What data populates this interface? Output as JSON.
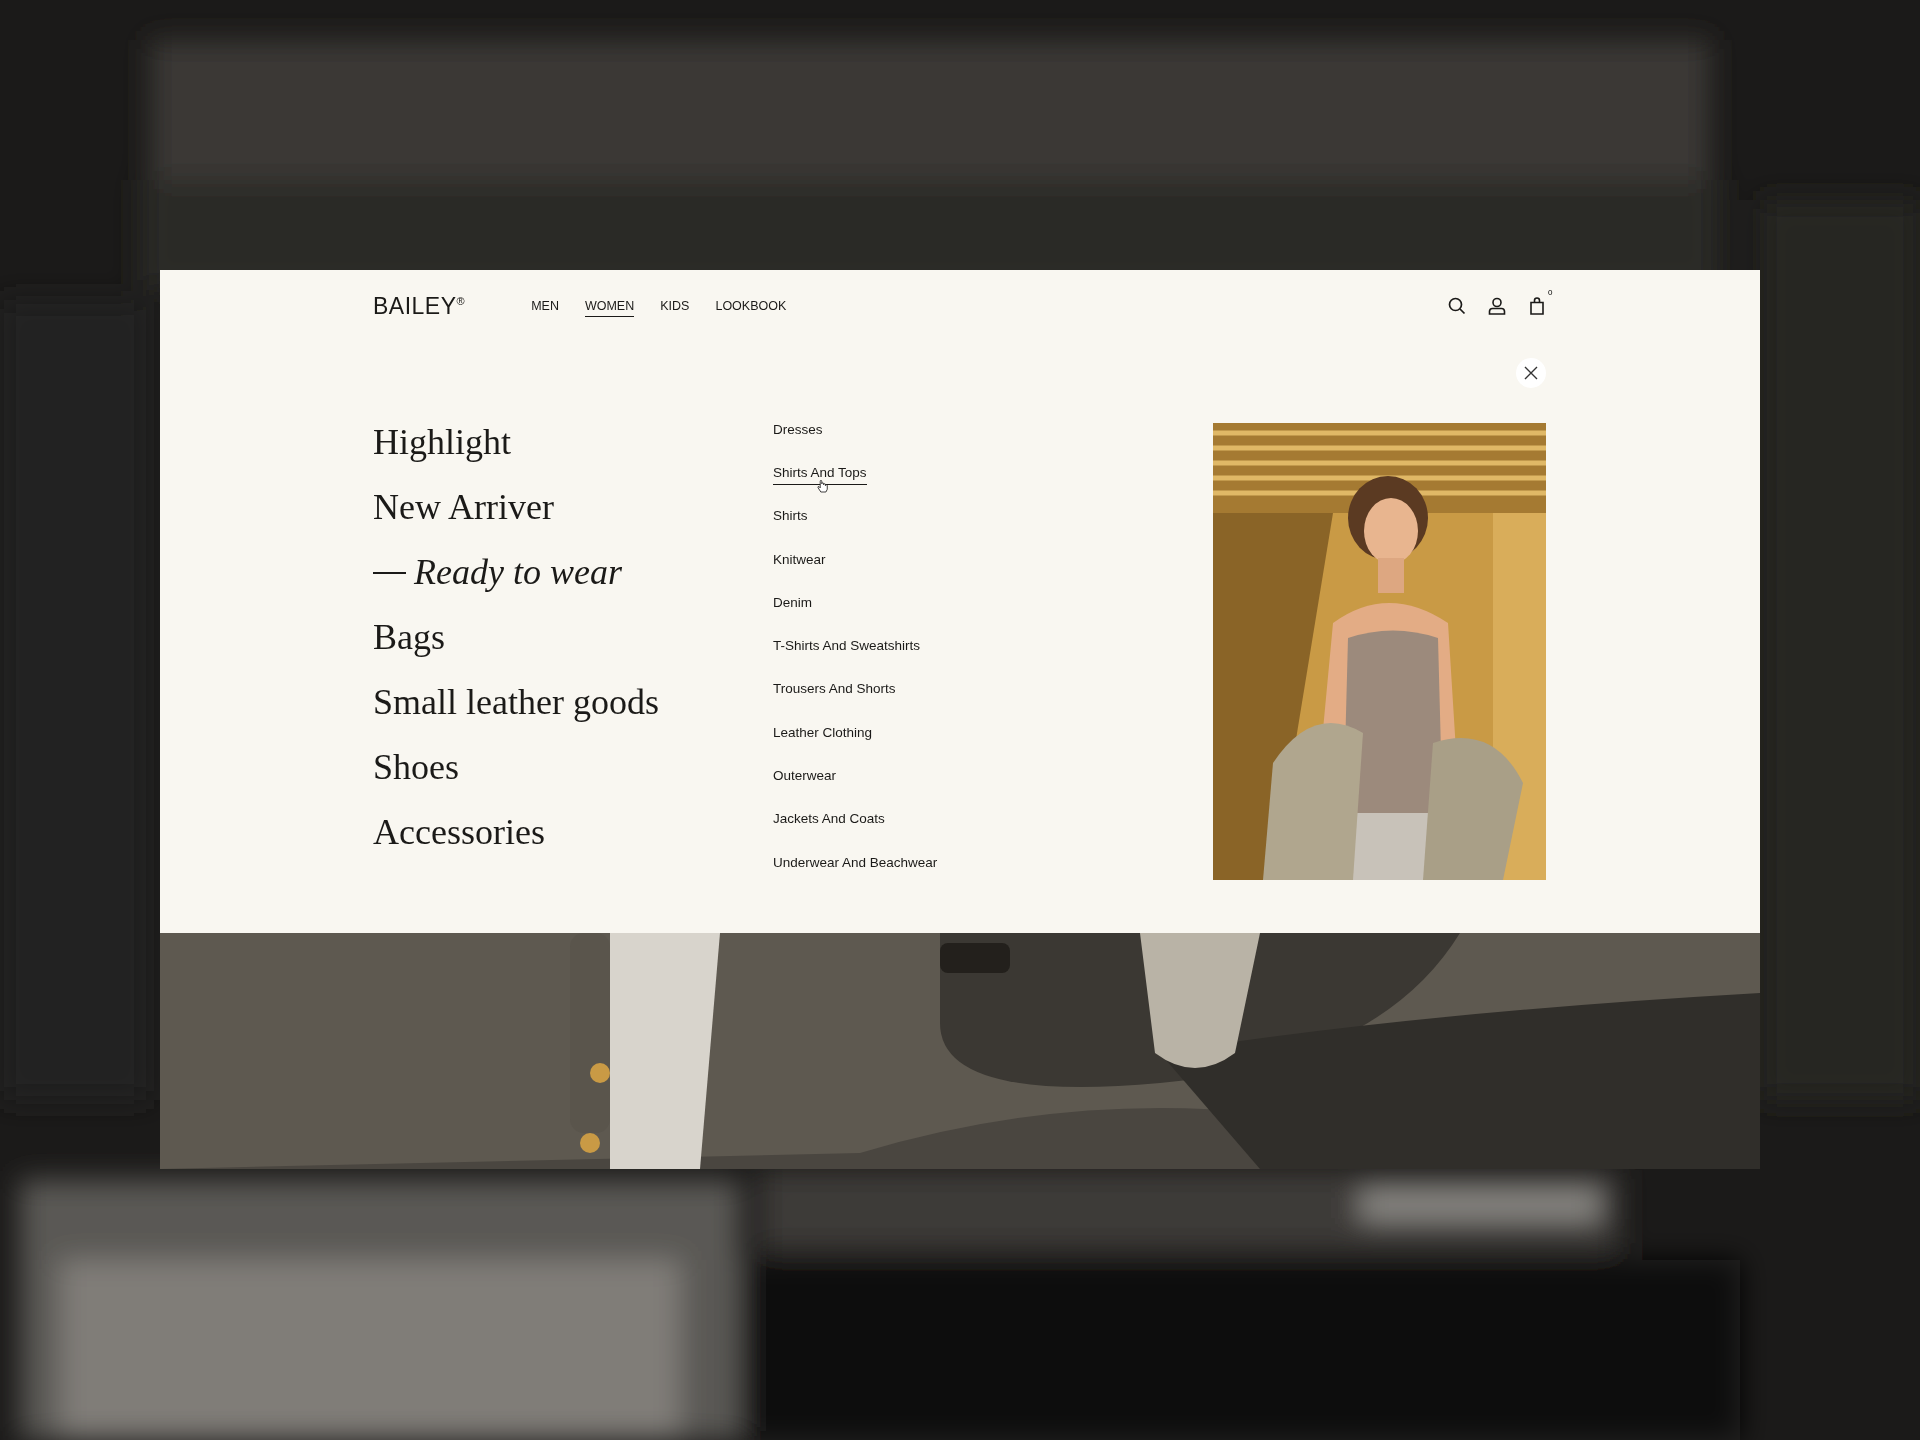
{
  "brand": {
    "name": "BAILEY$^{®}$"
  },
  "nav": [
    {
      "label": "MEN",
      "selected": false
    },
    {
      "label": "WOMEN",
      "selected": true
    },
    {
      "label": "KIDS",
      "selected": false
    },
    {
      "label": "LOOKBOOK",
      "selected": false
    }
  ],
  "cart": {
    "count": "0"
  },
  "categories": [
    {
      "label": "Highlight",
      "selected": false
    },
    {
      "label": "New Arriver",
      "selected": false
    },
    {
      "label": "Ready to wear",
      "selected": true
    },
    {
      "label": "Bags",
      "selected": false
    },
    {
      "label": "Small leather goods",
      "selected": false
    },
    {
      "label": "Shoes",
      "selected": false
    },
    {
      "label": "Accessories",
      "selected": false
    }
  ],
  "subcategories": [
    {
      "label": "Dresses",
      "hovered": false
    },
    {
      "label": "Shirts And Tops",
      "hovered": true
    },
    {
      "label": "Shirts",
      "hovered": false
    },
    {
      "label": "Knitwear",
      "hovered": false
    },
    {
      "label": "Denim",
      "hovered": false
    },
    {
      "label": "T-Shirts And Sweatshirts",
      "hovered": false
    },
    {
      "label": "Trousers And Shorts",
      "hovered": false
    },
    {
      "label": "Leather Clothing",
      "hovered": false
    },
    {
      "label": "Outerwear",
      "hovered": false
    },
    {
      "label": "Jackets And Coats",
      "hovered": false
    },
    {
      "label": "Underwear And Beachwear",
      "hovered": false
    }
  ]
}
